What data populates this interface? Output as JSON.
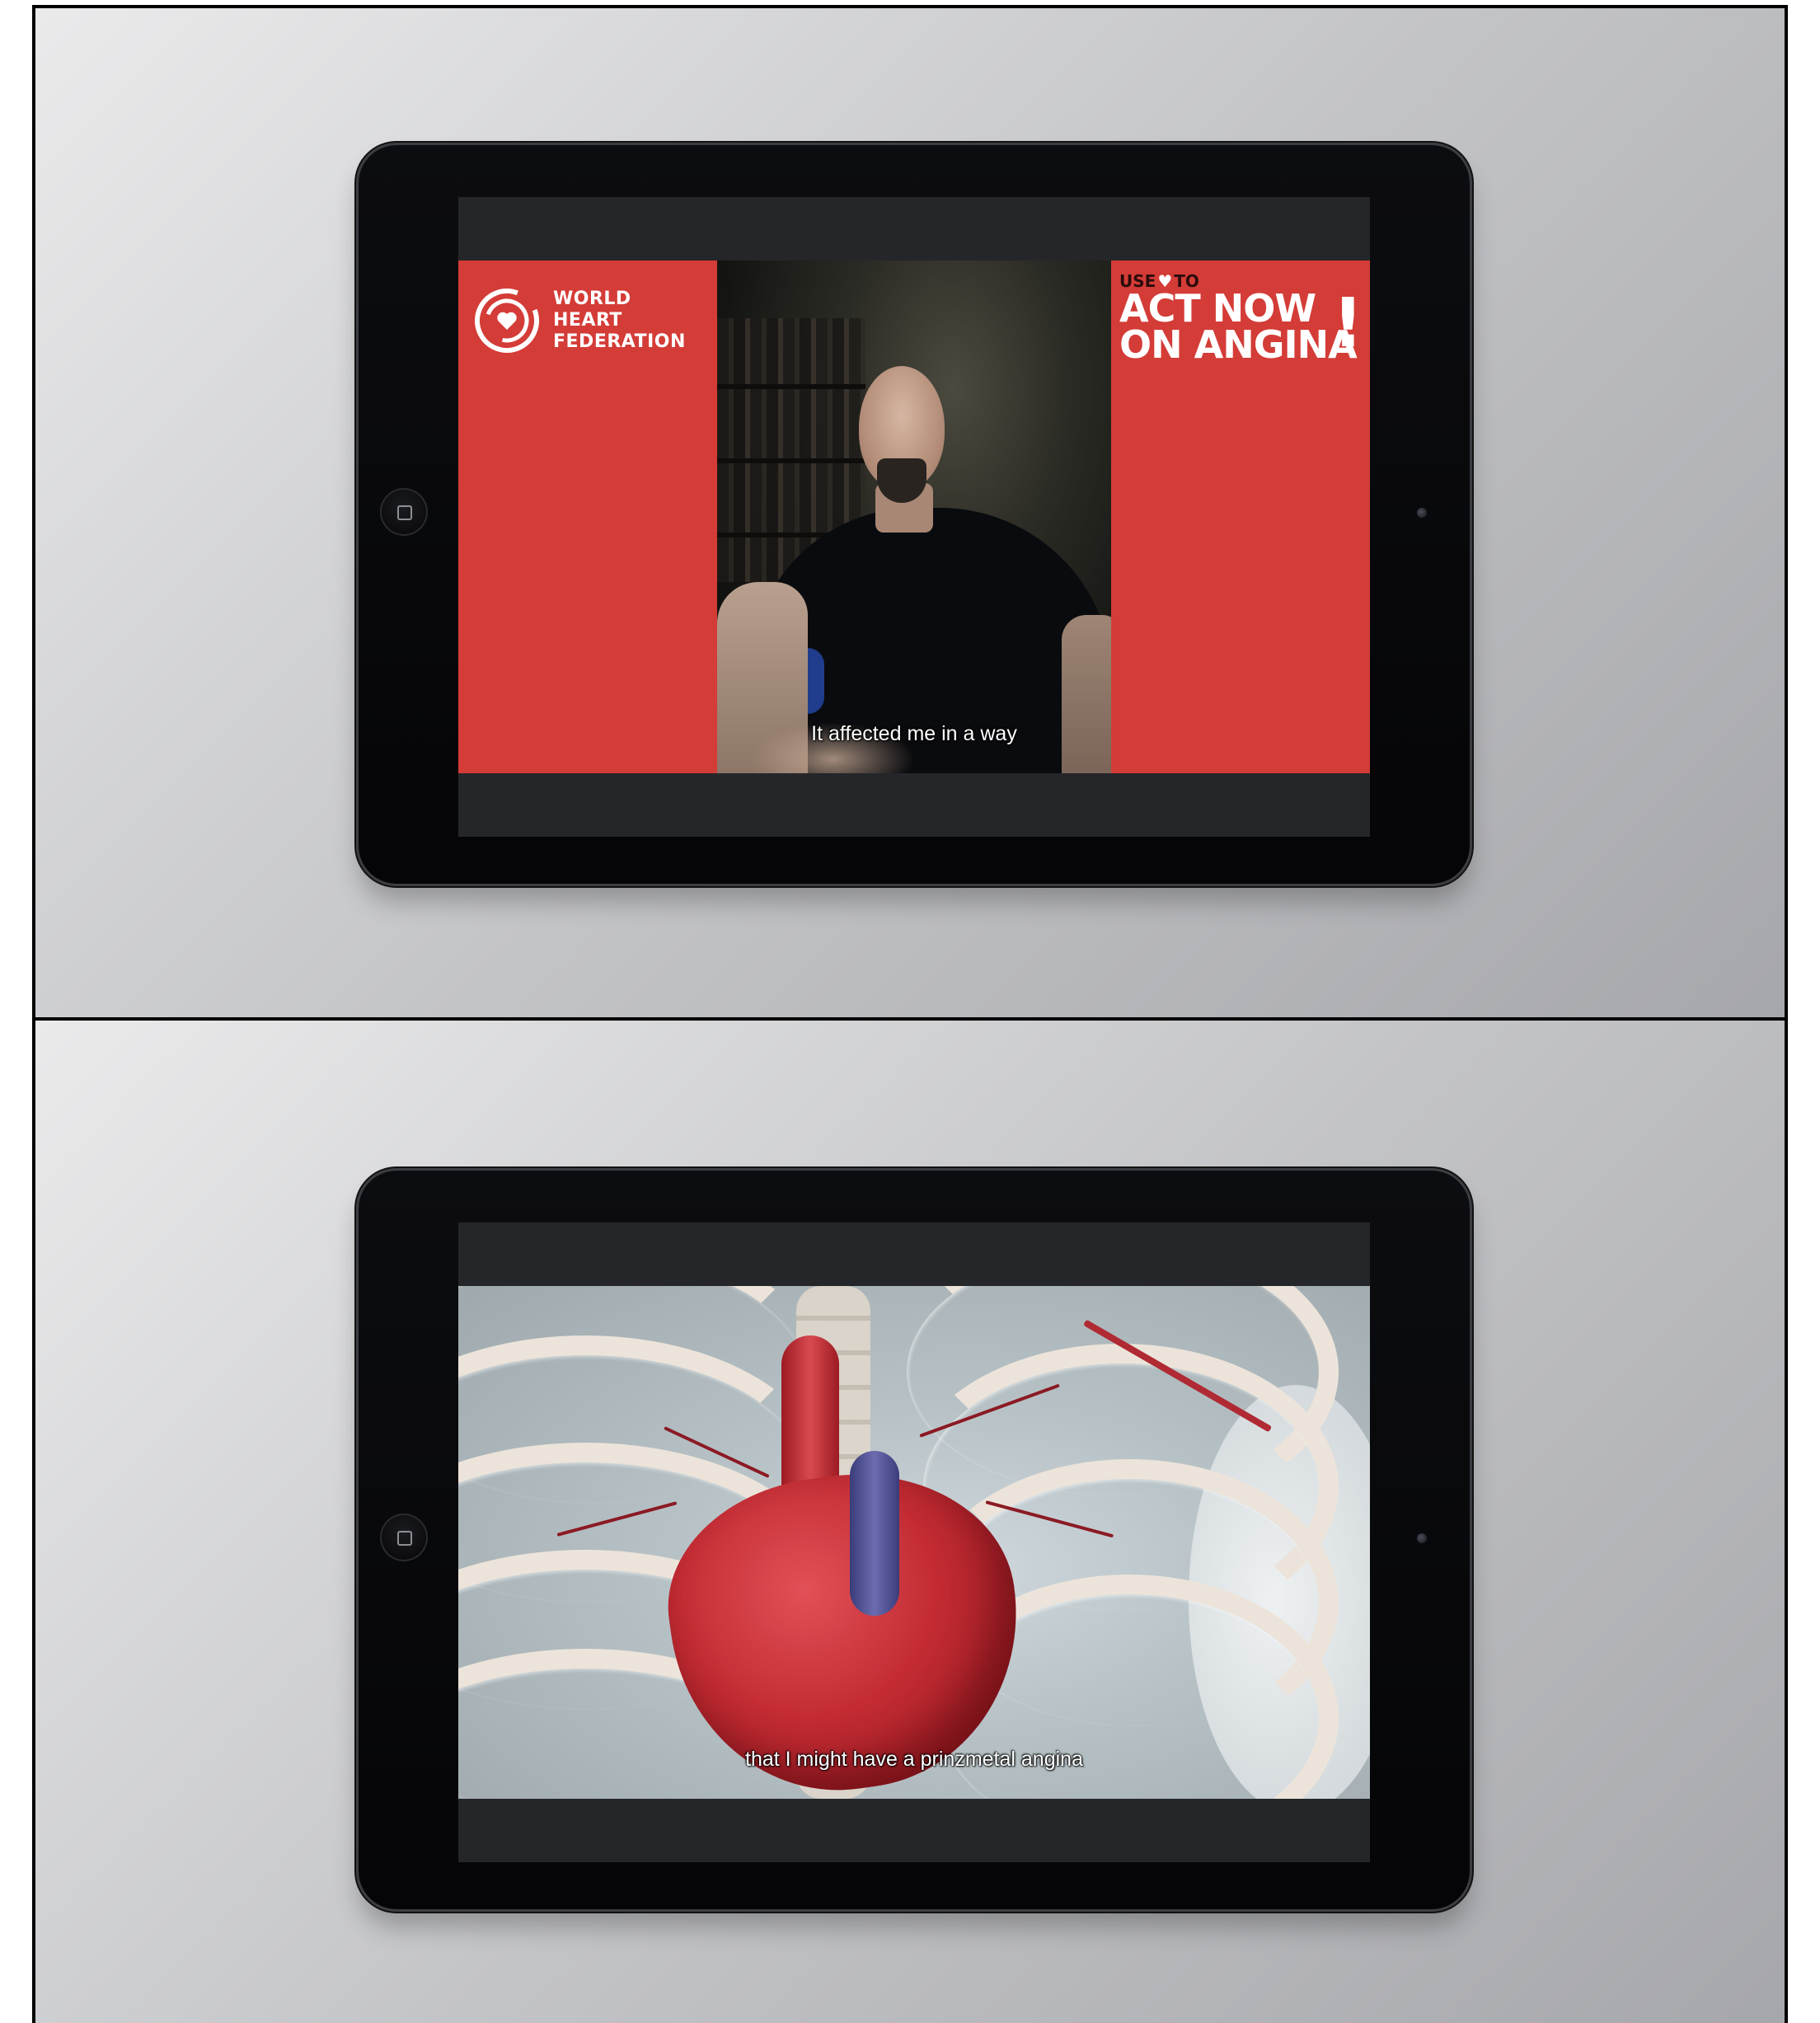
{
  "panels": {
    "top": {
      "left_logo": {
        "icon": "heart-circle-logo",
        "lines": [
          "WORLD",
          "HEART",
          "FEDERATION"
        ]
      },
      "campaign": {
        "use": "USE",
        "heart_icon": "heart-icon",
        "to": "TO",
        "line1": "ACT NOW",
        "line2": "ON ANGINA",
        "bang": "!"
      },
      "subtitle": "It affected me in a way",
      "colors": {
        "brand_red": "#d43c37"
      }
    },
    "bottom": {
      "subtitle": "that I might have a prinzmetal angina"
    }
  }
}
